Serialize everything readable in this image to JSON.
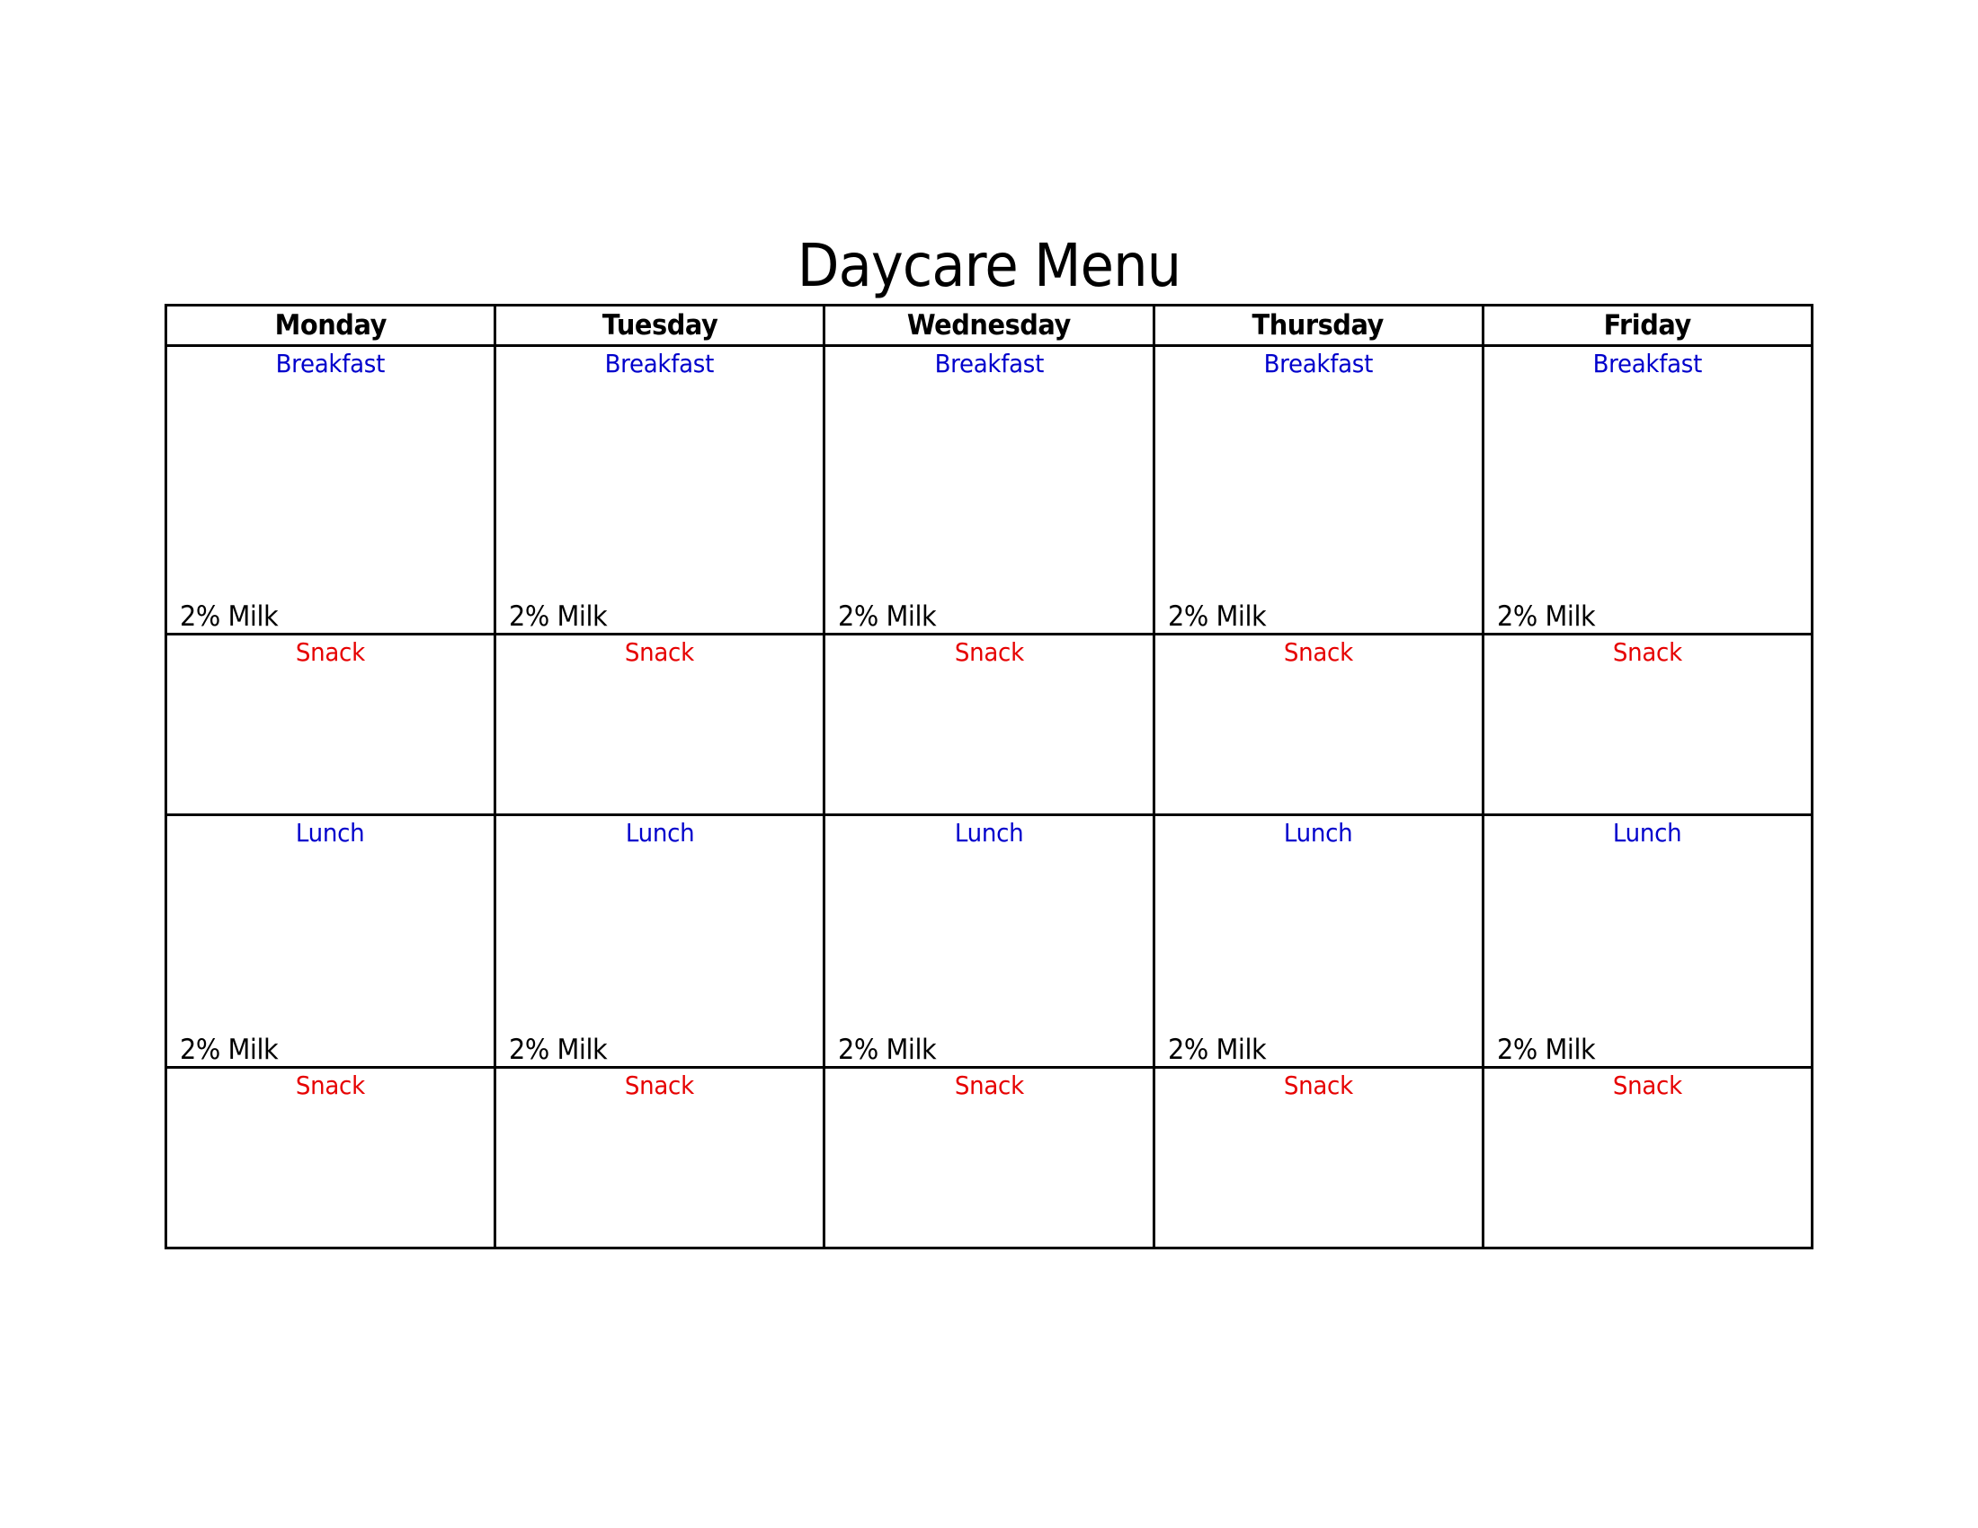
{
  "title": "Daycare Menu",
  "days": [
    "Monday",
    "Tuesday",
    "Wednesday",
    "Thursday",
    "Friday"
  ],
  "rows": [
    {
      "meal": "Breakfast",
      "color": "#0000cc",
      "footer": "2% Milk"
    },
    {
      "meal": "Snack",
      "color": "#e60000",
      "footer": ""
    },
    {
      "meal": "Lunch",
      "color": "#0000cc",
      "footer": "2% Milk"
    },
    {
      "meal": "Snack",
      "color": "#e60000",
      "footer": ""
    }
  ]
}
